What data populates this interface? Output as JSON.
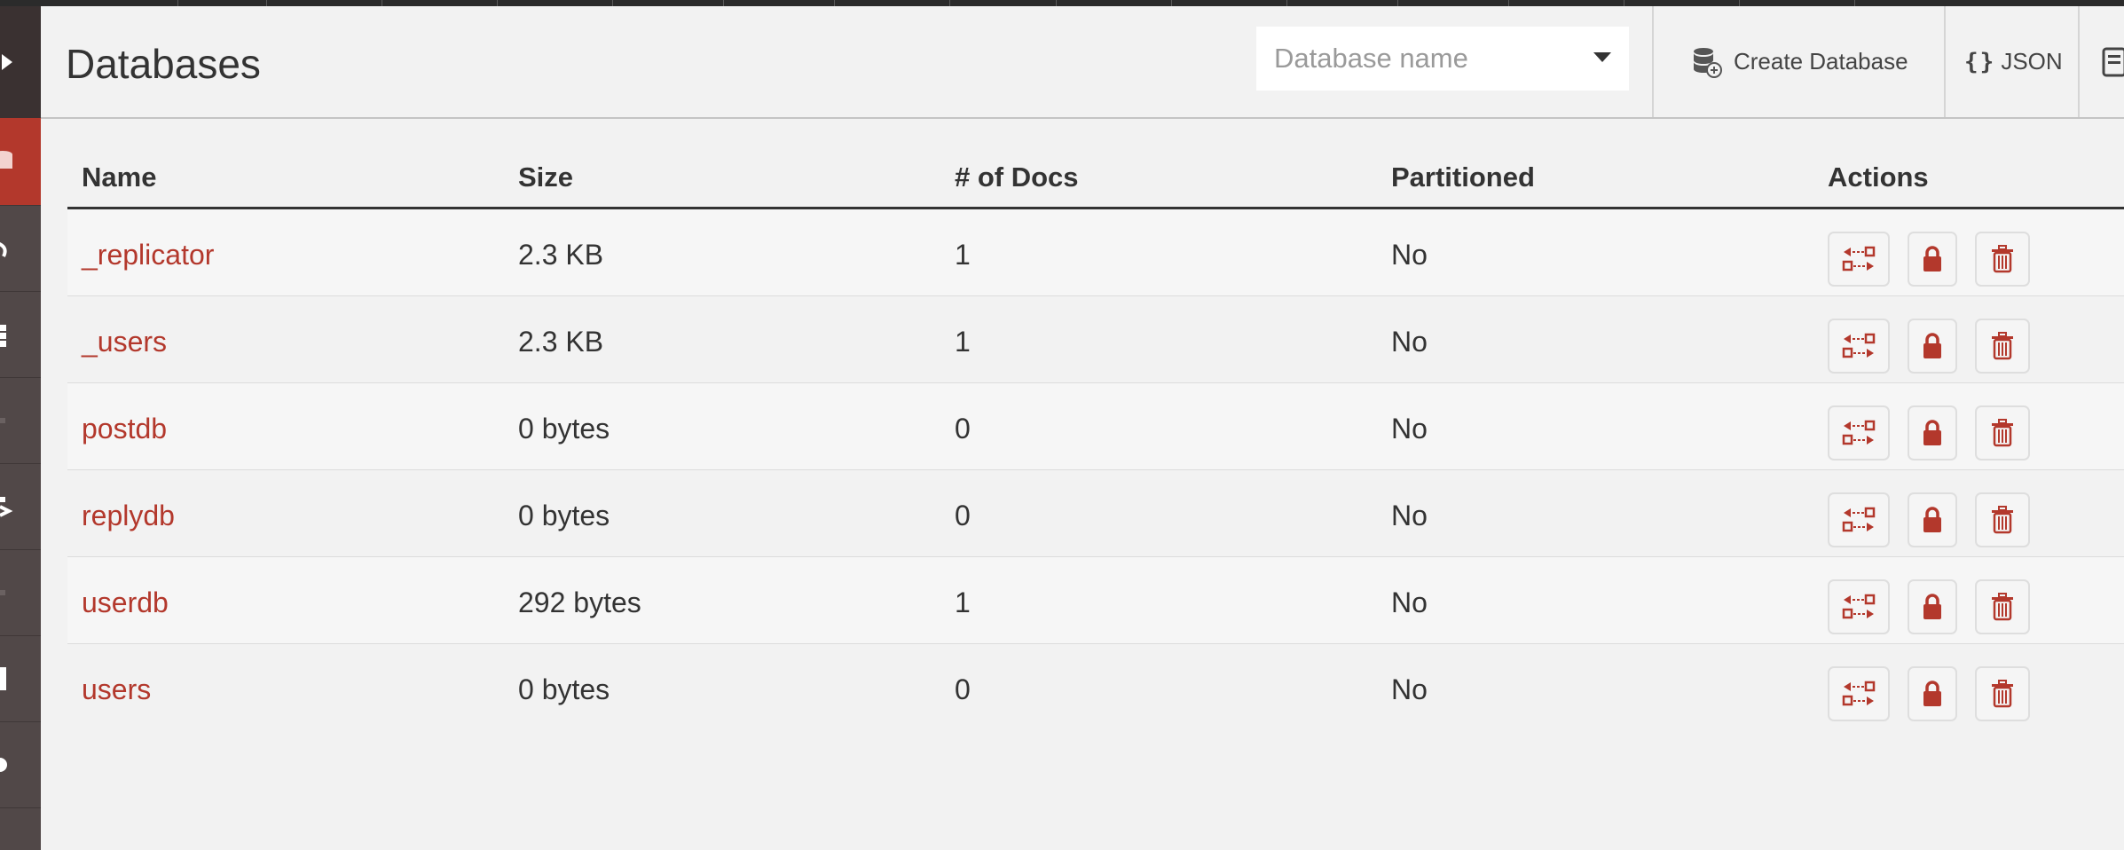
{
  "header": {
    "title": "Databases",
    "search_placeholder": "Database name",
    "create_label": "Create Database",
    "json_label": "JSON"
  },
  "table": {
    "columns": [
      "Name",
      "Size",
      "# of Docs",
      "Partitioned",
      "Actions"
    ],
    "rows": [
      {
        "name": "_replicator",
        "size": "2.3 KB",
        "docs": "1",
        "partitioned": "No"
      },
      {
        "name": "_users",
        "size": "2.3 KB",
        "docs": "1",
        "partitioned": "No"
      },
      {
        "name": "postdb",
        "size": "0 bytes",
        "docs": "0",
        "partitioned": "No"
      },
      {
        "name": "replydb",
        "size": "0 bytes",
        "docs": "0",
        "partitioned": "No"
      },
      {
        "name": "userdb",
        "size": "292 bytes",
        "docs": "1",
        "partitioned": "No"
      },
      {
        "name": "users",
        "size": "0 bytes",
        "docs": "0",
        "partitioned": "No"
      }
    ],
    "row_actions": [
      "replicate-icon",
      "lock-icon",
      "trash-icon"
    ]
  },
  "sidebar": {
    "icons": [
      "expand-arrow-icon",
      "databases-icon",
      "setup-icon",
      "grid-icon",
      "config-icon",
      "replication-icon",
      "tasks-icon",
      "docs-icon",
      "user-icon"
    ],
    "active_index": 1
  },
  "colors": {
    "accent": "#b3382c",
    "sidebar_bg": "#514848",
    "page_bg": "#f2f2f2",
    "text": "#333333"
  }
}
